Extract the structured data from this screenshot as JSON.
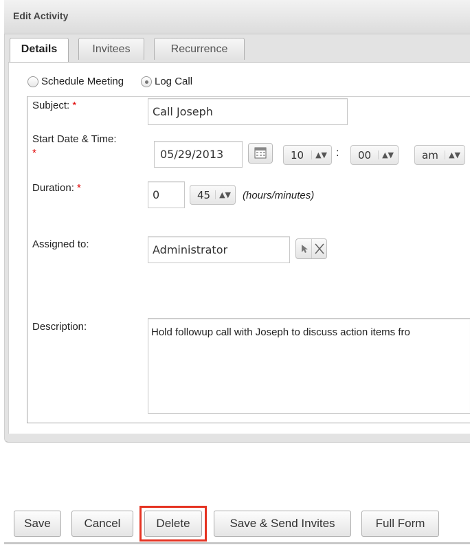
{
  "dialog": {
    "title": "Edit Activity"
  },
  "tabs": [
    {
      "label": "Details",
      "active": true
    },
    {
      "label": "Invitees",
      "active": false
    },
    {
      "label": "Recurrence",
      "active": false
    }
  ],
  "activity_type": {
    "options": [
      "Schedule Meeting",
      "Log Call"
    ],
    "selected": "Log Call"
  },
  "form": {
    "required_marker": "*",
    "subject": {
      "label": "Subject:",
      "value": "Call Joseph"
    },
    "start": {
      "label": "Start Date & Time:",
      "date": "05/29/2013",
      "hour": "10",
      "separator": ":",
      "minute": "00",
      "meridiem": "am"
    },
    "duration": {
      "label": "Duration:",
      "hours": "0",
      "minutes": "45",
      "hint": "(hours/minutes)"
    },
    "assigned": {
      "label": "Assigned to:",
      "value": "Administrator"
    },
    "description": {
      "label": "Description:",
      "value": "Hold followup call with Joseph to discuss action items fro"
    }
  },
  "buttons": {
    "save": "Save",
    "cancel": "Cancel",
    "delete": "Delete",
    "save_send": "Save & Send Invites",
    "full_form": "Full Form"
  },
  "highlight_color": "#e53322"
}
